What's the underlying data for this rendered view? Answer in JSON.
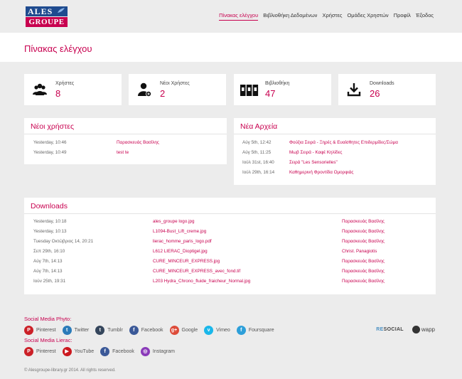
{
  "brand": {
    "line1": "ALES",
    "line2": "GROUPE"
  },
  "nav": [
    {
      "label": "Πίνακας ελέγχου",
      "active": true
    },
    {
      "label": "Βιβλιοθήκη Δεδομένων"
    },
    {
      "label": "Χρήστες"
    },
    {
      "label": "Ομάδες Χρηστών"
    },
    {
      "label": "Προφίλ"
    },
    {
      "label": "Έξοδος"
    }
  ],
  "page_title": "Πίνακας ελέγχου",
  "stats": [
    {
      "label": "Χρήστες",
      "value": "8",
      "icon": "users-icon"
    },
    {
      "label": "Νέοι Χρήστες",
      "value": "2",
      "icon": "new-user-icon"
    },
    {
      "label": "Βιβλιοθήκη",
      "value": "47",
      "icon": "library-icon"
    },
    {
      "label": "Downloads",
      "value": "26",
      "icon": "download-icon"
    }
  ],
  "new_users": {
    "title": "Νέοι χρήστες",
    "rows": [
      {
        "time": "Yesterday, 10:46",
        "name": "Παρασκευάς Βασίλης"
      },
      {
        "time": "Yesterday, 10:49",
        "name": "test te"
      }
    ]
  },
  "new_files": {
    "title": "Νέα Αρχεία",
    "rows": [
      {
        "time": "Αύγ 5th, 12:42",
        "name": "Φούξια Σειρά - Ξηρές & Ευαίσθητες Επιδερμίδες/Σώμα"
      },
      {
        "time": "Αύγ 5th, 11:25",
        "name": "Μωβ Σειρά - Καφέ Κηλίδες"
      },
      {
        "time": "Ιούλ 31st, 16:40",
        "name": "Σειρά \"Les Sensorielles\""
      },
      {
        "time": "Ιούλ 29th, 16:14",
        "name": "Καθημερινή Φροντίδα Ομορφιάς"
      }
    ]
  },
  "downloads": {
    "title": "Downloads",
    "rows": [
      {
        "time": "Yesterday, 10:18",
        "file": "ales_groupe logo.jpg",
        "user": "Παρασκευάς Βασίλης"
      },
      {
        "time": "Yesterday, 10:13",
        "file": "L1094-Bust_Lift_creme.jpg",
        "user": "Παρασκευάς Βασίλης"
      },
      {
        "time": "Tuesday Οκτώβριος 14, 20:21",
        "file": "lierac_homme_paris_logo.pdf",
        "user": "Παρασκευάς Βασίλης"
      },
      {
        "time": "Σεπ 29th, 16:10",
        "file": "L612 LIERAC_Dioptigel.jpg",
        "user": "Christ. Panagiotis"
      },
      {
        "time": "Αύγ 7th, 14:13",
        "file": "CURE_MINCEUR_EXPRESS.jpg",
        "user": "Παρασκευάς Βασίλης"
      },
      {
        "time": "Αύγ 7th, 14:13",
        "file": "CURE_MINCEUR_EXPRESS_avec_fond.tif",
        "user": "Παρασκευάς Βασίλης"
      },
      {
        "time": "Ιούν 25th, 19:31",
        "file": "L203 Hydra_Chrono_fluide_fraicheur_Normal.jpg",
        "user": "Παρασκευάς Βασίλης"
      }
    ]
  },
  "social_phyto": {
    "label": "Social Media Phyto:",
    "items": [
      {
        "name": "Pinterest",
        "glyph": "P",
        "color": "#cb2027",
        "icon": "pinterest-icon"
      },
      {
        "name": "Twitter",
        "glyph": "t",
        "color": "#2b7bb9",
        "icon": "twitter-icon"
      },
      {
        "name": "Tumblr",
        "glyph": "t",
        "color": "#35465c",
        "icon": "tumblr-icon"
      },
      {
        "name": "Facebook",
        "glyph": "f",
        "color": "#3b5998",
        "icon": "facebook-icon"
      },
      {
        "name": "Google",
        "glyph": "g+",
        "color": "#dd4b39",
        "icon": "google-icon"
      },
      {
        "name": "Vimeo",
        "glyph": "v",
        "color": "#1ab7ea",
        "icon": "vimeo-icon"
      },
      {
        "name": "Foursquare",
        "glyph": "f",
        "color": "#2d9fd9",
        "icon": "foursquare-icon"
      }
    ]
  },
  "social_lierac": {
    "label": "Social Media Lierac:",
    "items": [
      {
        "name": "Pinterest",
        "glyph": "P",
        "color": "#cb2027",
        "icon": "pinterest-icon"
      },
      {
        "name": "YouTube",
        "glyph": "▶",
        "color": "#cc181e",
        "icon": "youtube-icon"
      },
      {
        "name": "Facebook",
        "glyph": "f",
        "color": "#3b5998",
        "icon": "facebook-icon"
      },
      {
        "name": "Instagram",
        "glyph": "◎",
        "color": "#8a3ab9",
        "icon": "instagram-icon"
      }
    ]
  },
  "credits": {
    "social_prefix": "RE",
    "social_rest": "SOCIAL",
    "wapp": "wapp"
  },
  "copyright": "© Alesgroupe-library.gr 2014. All rights reserved.",
  "colors": {
    "accent": "#c8004f",
    "brand_blue": "#1f4b8f"
  }
}
